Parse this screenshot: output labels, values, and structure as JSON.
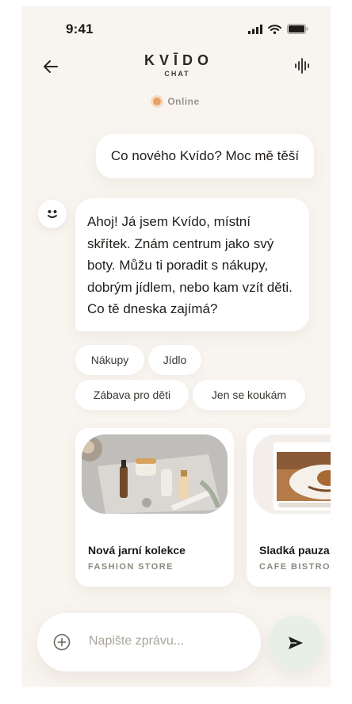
{
  "status_bar": {
    "time": "9:41",
    "icons": [
      "signal-icon",
      "wifi-icon",
      "battery-icon"
    ]
  },
  "header": {
    "brand": "KVĪDO",
    "subtitle": "CHAT",
    "icons": [
      "back-arrow-icon",
      "voice-waveform-icon"
    ]
  },
  "presence": {
    "label": "Online",
    "color": "#e8a066"
  },
  "messages": [
    {
      "from": "user",
      "text": "Co nového Kvído? Moc mě těší"
    },
    {
      "from": "bot",
      "text": "Ahoj! Já jsem Kvído, místní skřítek. Znám centrum jako svý boty. Můžu ti poradit s nákupy, dobrým jídlem, nebo kam vzít děti. Co tě dneska zajímá?"
    }
  ],
  "quick_replies": [
    "Nákupy",
    "Jídlo",
    "Zábava pro děti",
    "Jen se koukám"
  ],
  "cards": [
    {
      "title": "Nová jarní kolekce",
      "subtitle": "FASHION STORE"
    },
    {
      "title": "Sladká pauza",
      "subtitle": "CAFE BISTRO"
    }
  ],
  "composer": {
    "placeholder": "Napište zprávu...",
    "icons": [
      "plus-circle-icon",
      "send-icon"
    ]
  },
  "colors": {
    "background": "#f8f4ef",
    "accent": "#e8a066",
    "send_button": "#e7efe7"
  }
}
